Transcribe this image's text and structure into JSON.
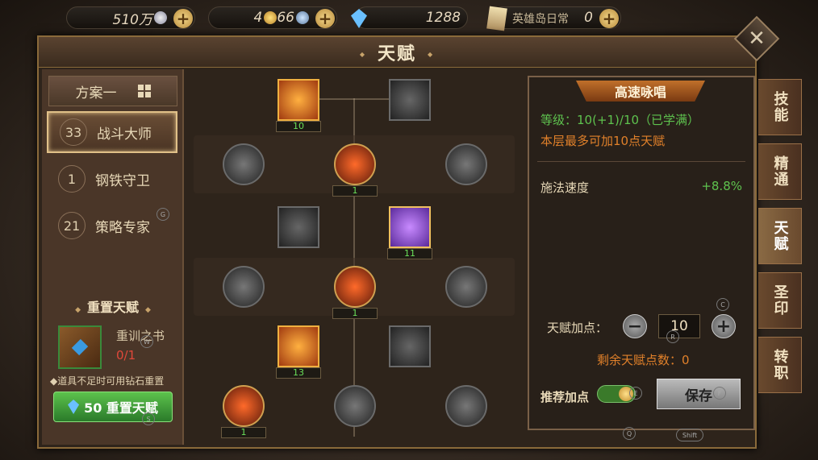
{
  "resources": {
    "silver": "510万",
    "gold_a": "4",
    "gold_b": "66",
    "gems": "1288",
    "hero_island_label": "英雄岛日常",
    "hero_island_count": "0"
  },
  "window": {
    "title": "天赋",
    "close": "✕"
  },
  "left": {
    "plan_label": "方案一",
    "specs": [
      {
        "points": "33",
        "name": "战斗大师"
      },
      {
        "points": "1",
        "name": "钢铁守卫"
      },
      {
        "points": "21",
        "name": "策略专家"
      }
    ],
    "reset_title": "重置天赋",
    "book_name": "重训之书",
    "book_count": "0/1",
    "hint": "◆道具不足时可用钻石重置",
    "reset_button": "50 重置天赋"
  },
  "tree": {
    "nodes": [
      {
        "level": "10"
      },
      {
        "level": "1"
      },
      {
        "level": "11"
      },
      {
        "level": "1"
      },
      {
        "level": "13"
      },
      {
        "level": "1"
      }
    ]
  },
  "detail": {
    "header": "高速咏唱",
    "level_text": "等级：10(+1)/10（已学满）",
    "note": "本层最多可加10点天赋",
    "stat_name": "施法速度",
    "stat_value": "+8.8%",
    "points_label": "天赋加点：",
    "minus": "−",
    "plus": "+",
    "points_value": "10",
    "remaining": "剩余天赋点数：0",
    "recommend_label": "推荐加点",
    "save_button": "保存"
  },
  "side_tabs": [
    "技能",
    "精通",
    "天赋",
    "圣印",
    "转职"
  ],
  "key_hints": {
    "a": "C",
    "b": "R",
    "c": "F",
    "d": "E",
    "e": "Q",
    "f": "Shift",
    "g": "W",
    "h": "S",
    "i": "G"
  }
}
